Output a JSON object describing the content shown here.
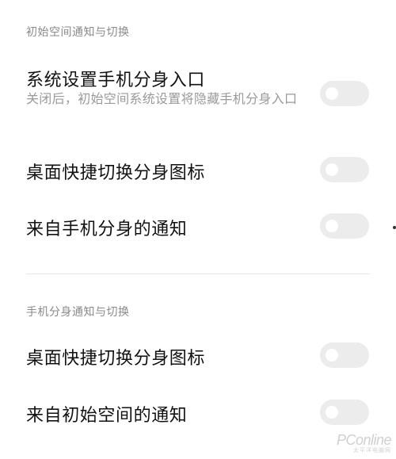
{
  "sections": [
    {
      "header": "初始空间通知与切换",
      "items": [
        {
          "title": "系统设置手机分身入口",
          "subtitle": "关闭后，初始空间系统设置将隐藏手机分身入口",
          "toggle_state": "off"
        },
        {
          "title": "桌面快捷切换分身图标",
          "toggle_state": "off"
        },
        {
          "title": "来自手机分身的通知",
          "toggle_state": "off"
        }
      ]
    },
    {
      "header": "手机分身通知与切换",
      "items": [
        {
          "title": "桌面快捷切换分身图标",
          "toggle_state": "off"
        },
        {
          "title": "来自初始空间的通知",
          "toggle_state": "off"
        }
      ]
    }
  ],
  "watermark": {
    "logo": "PConline",
    "sub": "太平洋电脑网"
  },
  "colors": {
    "toggle_off_track": "#ececec",
    "toggle_knob": "#ffffff",
    "header_text": "#8a8a8a",
    "subtitle_text": "#9a9a9a"
  }
}
